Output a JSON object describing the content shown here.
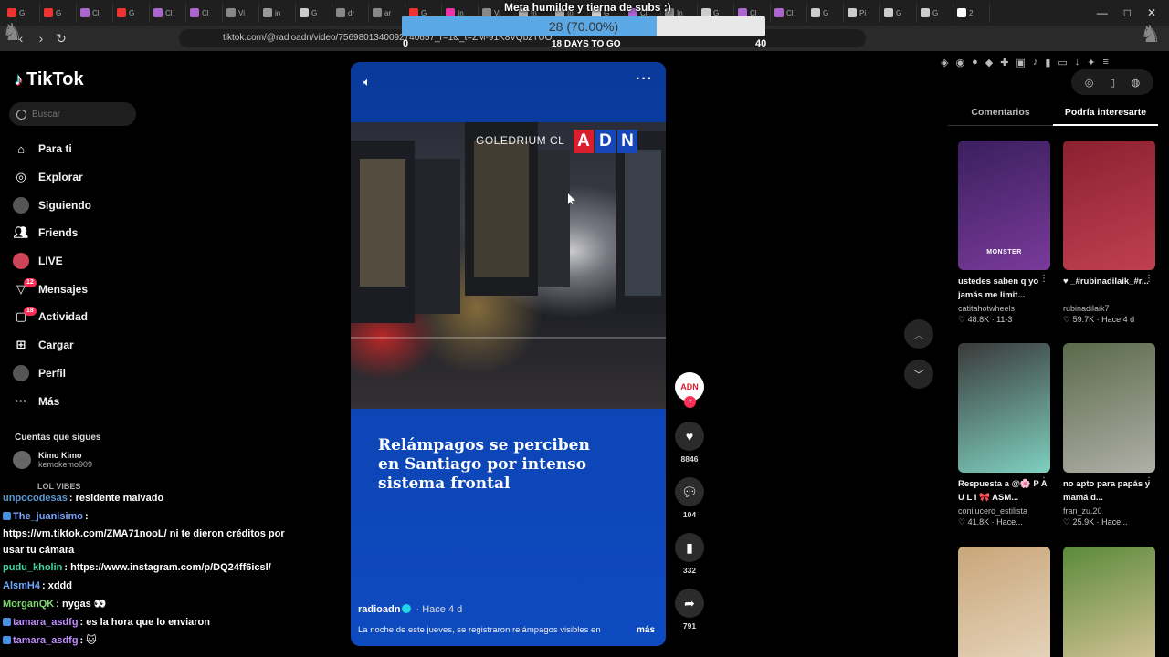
{
  "browser": {
    "tabs": [
      "G",
      "G",
      "Cl",
      "G",
      "Cl",
      "Cl",
      "Vi",
      "in",
      "G",
      "dr",
      "ar",
      "G",
      "In",
      "Vi",
      "In",
      "In",
      "G",
      "Cl",
      "In",
      "G",
      "Cl",
      "Cl",
      "G",
      "Pi",
      "G",
      "G",
      "2"
    ],
    "url": "tiktok.com/@radioadn/video/7569801340092740657_r=1&_t=ZM-91K8VQbzTUO",
    "window_controls": [
      "—",
      "□",
      "✕"
    ]
  },
  "stream_overlay": {
    "goal_title": "Meta humilde y tierna de subs :)",
    "goal_text": "28 (70.00%)",
    "goal_progress": 0.7,
    "goal_min": "0",
    "goal_max": "40",
    "days_left": "18 DAYS TO GO"
  },
  "sidebar": {
    "logo": "TikTok",
    "search_placeholder": "Buscar",
    "items": [
      {
        "label": "Para ti",
        "icon": "home-icon"
      },
      {
        "label": "Explorar",
        "icon": "compass-icon"
      },
      {
        "label": "Siguiendo",
        "icon": "following-avatar"
      },
      {
        "label": "Friends",
        "icon": "friends-icon"
      },
      {
        "label": "LIVE",
        "icon": "live-icon"
      },
      {
        "label": "Mensajes",
        "icon": "messages-icon",
        "badge": "12"
      },
      {
        "label": "Actividad",
        "icon": "activity-icon",
        "badge": "18"
      },
      {
        "label": "Cargar",
        "icon": "upload-icon"
      },
      {
        "label": "Perfil",
        "icon": "profile-avatar"
      },
      {
        "label": "Más",
        "icon": "more-icon"
      }
    ],
    "following_heading": "Cuentas que sigues",
    "following": [
      {
        "name": "Kimo Kimo",
        "handle": "kemokemo909"
      },
      {
        "name": "LOL VIBES",
        "handle": ""
      }
    ]
  },
  "chat": [
    {
      "user": "unpocodesas",
      "color": "#5b9bd5",
      "message": "residente malvado"
    },
    {
      "user": "The_juanisimo",
      "color": "#7ba4ff",
      "message": ""
    },
    {
      "user": "",
      "color": "#ffffff",
      "message": "https://vm.tiktok.com/ZMA71nooL/ ni te dieron créditos por usar tu cámara"
    },
    {
      "user": "pudu_kholin",
      "color": "#3fd6a6",
      "message": "https://www.instagram.com/p/DQ24ff6icsl/"
    },
    {
      "user": "AlsmH4",
      "color": "#6fa8ff",
      "message": "xddd"
    },
    {
      "user": "MorganQK",
      "color": "#7dd86e",
      "message": "nygas 👀"
    },
    {
      "user": "tamara_asdfg",
      "color": "#c08cff",
      "message": "es la hora que lo enviaron"
    },
    {
      "user": "tamara_asdfg",
      "color": "#c08cff",
      "message": "🐱"
    }
  ],
  "video": {
    "watermark": "GOLEDRIUM CL",
    "channel_logo": [
      "A",
      "D",
      "N"
    ],
    "headline": "Relámpagos se perciben en Santiago por intenso sistema frontal",
    "author": "radioadn",
    "posted": "Hace 4 d",
    "caption": "La noche de este jueves, se registraron relámpagos visibles en",
    "more_label": "más",
    "author_avatar_text": "ADN"
  },
  "actions": {
    "likes": "8846",
    "comments": "104",
    "saves": "332",
    "shares": "791"
  },
  "right_panel": {
    "tabs": [
      "Comentarios",
      "Podría interesarte"
    ],
    "active_tab": 1,
    "cards": [
      {
        "title": "ustedes saben q yo jamás me limit...",
        "user": "catitahotwheels",
        "stats": "48.8K · 11-3",
        "thumb_label": "MONSTER",
        "colors": [
          "#3a1f5e",
          "#7a3a9a"
        ]
      },
      {
        "title": "♥ _#rubinadilaik_#r...",
        "user": "rubinadilaik7",
        "stats": "59.7K · Hace 4 d",
        "thumb_label": "",
        "colors": [
          "#8a2030",
          "#c04050"
        ]
      },
      {
        "title": "Respuesta a @🌸 P A U L I 🎀 ASM...",
        "user": "conilucero_estilista",
        "stats": "41.8K · Hace...",
        "thumb_label": "",
        "colors": [
          "#3a3a3a",
          "#7fd0c0"
        ]
      },
      {
        "title": "no apto para papás y mamá d...",
        "user": "fran_zu.20",
        "stats": "25.9K · Hace...",
        "thumb_label": "",
        "colors": [
          "#5a6a4a",
          "#b0b0a8"
        ]
      },
      {
        "title": "",
        "user": "",
        "stats": "",
        "thumb_label": "",
        "colors": [
          "#c9a67a",
          "#e8d8c0"
        ]
      },
      {
        "title": "",
        "user": "",
        "stats": "",
        "thumb_label": "",
        "colors": [
          "#5a8a3a",
          "#e0c8a0"
        ]
      }
    ]
  }
}
